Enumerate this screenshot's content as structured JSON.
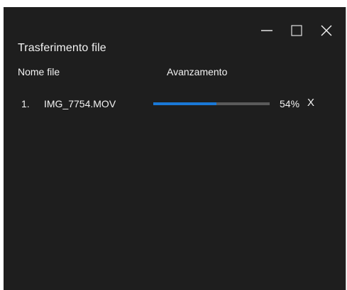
{
  "window": {
    "title": "Trasferimento file",
    "controls": {
      "minimize_icon": "minimize-icon",
      "maximize_icon": "maximize-icon",
      "close_icon": "close-icon"
    }
  },
  "table": {
    "headers": {
      "name": "Nome file",
      "progress": "Avanzamento"
    },
    "rows": [
      {
        "index": "1.",
        "file_name": "IMG_7754.MOV",
        "progress": 0.54,
        "percent_label": "54%",
        "cancel_label": "X"
      }
    ]
  },
  "colors": {
    "background": "#1e1e1e",
    "text": "#f2f2f2",
    "progress_fill": "#1a78d6",
    "progress_track": "#5a5a5a"
  }
}
